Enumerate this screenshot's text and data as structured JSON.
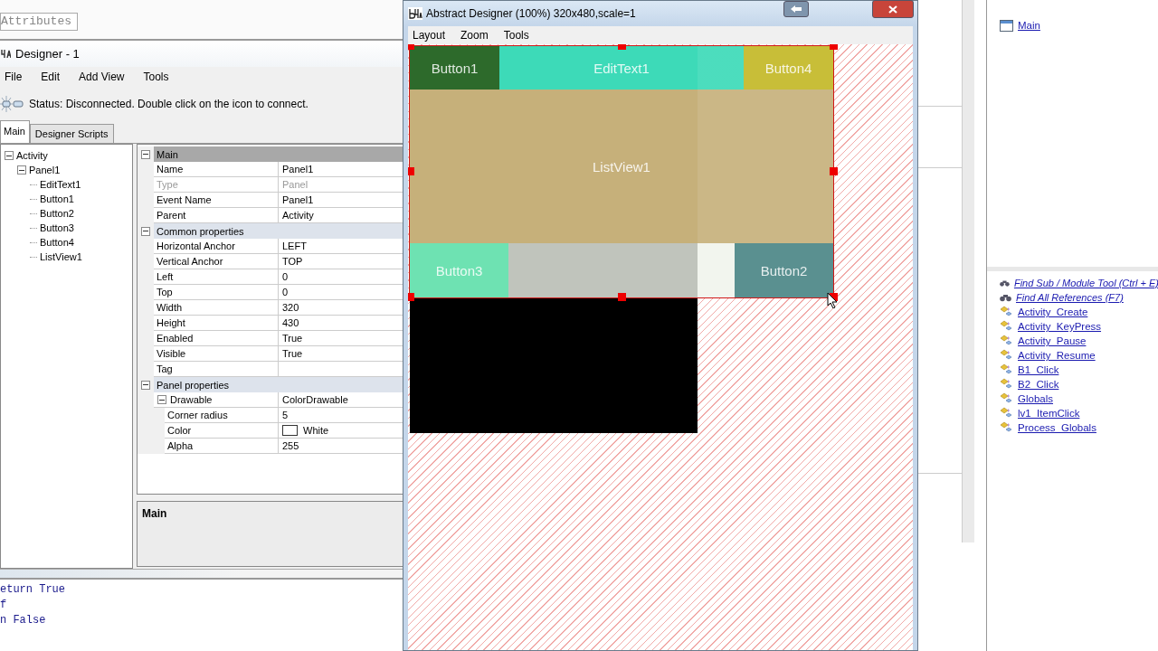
{
  "left_ide": {
    "attributes_field": "Attributes",
    "code_lines": [
      "eturn True",
      "f",
      "n False"
    ]
  },
  "designer": {
    "title": "Designer - 1",
    "menu": [
      "File",
      "Edit",
      "Add View",
      "Tools"
    ],
    "status": "Status: Disconnected. Double click on the icon to connect.",
    "tabs": [
      {
        "label": "Main",
        "selected": true
      },
      {
        "label": "Designer Scripts",
        "selected": false
      }
    ],
    "tree": [
      {
        "label": "Activity",
        "expanded": true,
        "children": [
          {
            "label": "Panel1",
            "expanded": true,
            "children": [
              {
                "label": "EditText1"
              },
              {
                "label": "Button1"
              },
              {
                "label": "Button2"
              },
              {
                "label": "Button3"
              },
              {
                "label": "Button4"
              },
              {
                "label": "ListView1"
              }
            ]
          }
        ]
      }
    ],
    "property_groups": [
      {
        "label": "Main",
        "selected": true,
        "expanded": true,
        "rows": [
          {
            "name": "Name",
            "value": "Panel1",
            "disabled": false
          },
          {
            "name": "Type",
            "value": "Panel",
            "disabled": true
          },
          {
            "name": "Event Name",
            "value": "Panel1",
            "disabled": false
          },
          {
            "name": "Parent",
            "value": "Activity",
            "disabled": false
          }
        ]
      },
      {
        "label": "Common properties",
        "selected": false,
        "expanded": true,
        "rows": [
          {
            "name": "Horizontal Anchor",
            "value": "LEFT",
            "disabled": false
          },
          {
            "name": "Vertical Anchor",
            "value": "TOP",
            "disabled": false
          },
          {
            "name": "Left",
            "value": "0",
            "disabled": false
          },
          {
            "name": "Top",
            "value": "0",
            "disabled": false
          },
          {
            "name": "Width",
            "value": "320",
            "disabled": false
          },
          {
            "name": "Height",
            "value": "430",
            "disabled": false
          },
          {
            "name": "Enabled",
            "value": "True",
            "disabled": false
          },
          {
            "name": "Visible",
            "value": "True",
            "disabled": false
          },
          {
            "name": "Tag",
            "disabled": false
          }
        ]
      },
      {
        "label": "Panel properties",
        "selected": false,
        "expanded": true,
        "rows": [
          {
            "name": "Drawable",
            "value": "ColorDrawable",
            "disabled": false,
            "expanded": true,
            "children": [
              {
                "name": "Corner radius",
                "value": "5",
                "disabled": false
              },
              {
                "kind": "color",
                "name": "Color",
                "value": "White",
                "disabled": false
              },
              {
                "name": "Alpha",
                "value": "255",
                "disabled": false
              }
            ]
          }
        ]
      }
    ],
    "description": "Main"
  },
  "abstract_designer": {
    "title": "Abstract Designer (100%) 320x480,scale=1",
    "menu": [
      "Layout",
      "Zoom",
      "Tools"
    ],
    "view_rows": [
      [
        {
          "kind": "button",
          "label": "Button1",
          "color": "#2d6a2b"
        },
        {
          "kind": "edittext",
          "label": "EditText1",
          "color": "#3ddab8"
        },
        {
          "kind": "button",
          "label": "Button4",
          "color": "#c8be38"
        }
      ],
      [
        {
          "kind": "listview",
          "label": "ListView1",
          "color": "#c6b07a"
        }
      ],
      [
        {
          "kind": "button",
          "label": "Button3",
          "color": "#6ee2b2"
        },
        {
          "kind": "button",
          "label": "Button2",
          "color": "#5a9090"
        }
      ]
    ]
  },
  "modules": {
    "main": "Main",
    "entries": [
      {
        "kind": "tool",
        "label": "Find Sub / Module Tool (Ctrl + E)"
      },
      {
        "kind": "tool",
        "label": "Find All References (F7)"
      },
      {
        "kind": "sub",
        "label": "Activity_Create"
      },
      {
        "kind": "sub",
        "label": "Activity_KeyPress"
      },
      {
        "kind": "sub",
        "label": "Activity_Pause"
      },
      {
        "kind": "sub",
        "label": "Activity_Resume"
      },
      {
        "kind": "sub",
        "label": "B1_Click"
      },
      {
        "kind": "sub",
        "label": "B2_Click"
      },
      {
        "kind": "sub",
        "label": "Globals"
      },
      {
        "kind": "sub",
        "label": "lv1_ItemClick"
      },
      {
        "kind": "sub",
        "label": "Process_Globals"
      }
    ]
  }
}
